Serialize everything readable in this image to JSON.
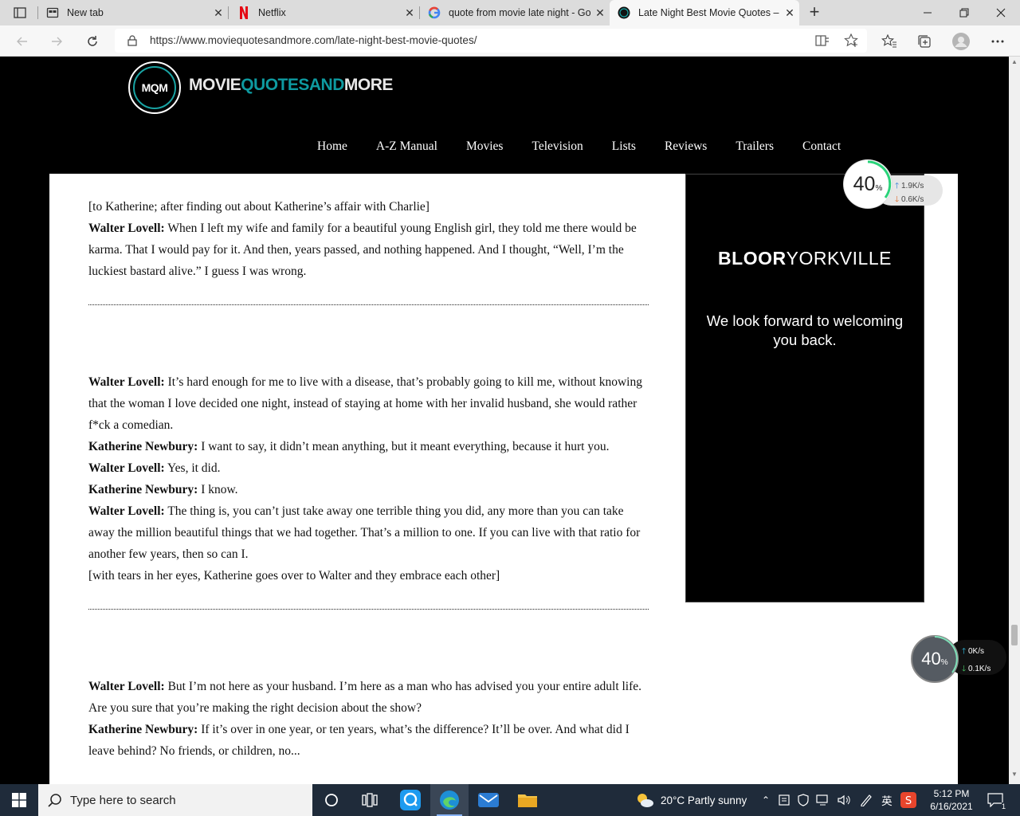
{
  "browser": {
    "tabs": [
      {
        "label": "New tab",
        "icon": "new-tab-page-icon",
        "active": false
      },
      {
        "label": "Netflix",
        "icon": "netflix-icon",
        "active": false
      },
      {
        "label": "quote from movie late night - Go",
        "icon": "google-icon",
        "active": false
      },
      {
        "label": "Late Night Best Movie Quotes –",
        "icon": "site-favicon",
        "active": true
      }
    ],
    "new_tab_symbol": "+",
    "close_symbol": "✕",
    "url": "https://www.moviequotesandmore.com/late-night-best-movie-quotes/"
  },
  "site": {
    "logo_mark": "MQM",
    "logo_word_1": "MOVIE",
    "logo_word_2": "QUOTESAND",
    "logo_word_3": "MORE",
    "nav": [
      "Home",
      "A-Z Manual",
      "Movies",
      "Television",
      "Lists",
      "Reviews",
      "Trailers",
      "Contact"
    ]
  },
  "article": {
    "block1": {
      "stage": "[to Katherine; after finding out about Katherine’s affair with Charlie]",
      "speaker": "Walter Lovell:",
      "line": " When I left my wife and family for a beautiful young English girl, they told me there would be karma. That I would pay for it. And then, years passed, and nothing happened. And I thought, “Well, I’m the luckiest bastard alive.” I guess I was wrong."
    },
    "block2": [
      {
        "speaker": "Walter Lovell:",
        "line": " It’s hard enough for me to live with a disease, that’s probably going to kill me, without knowing that the woman I love decided one night, instead of staying at home with her invalid husband, she would rather f*ck a comedian."
      },
      {
        "speaker": "Katherine Newbury:",
        "line": " I want to say, it didn’t mean anything, but it meant everything, because it hurt you."
      },
      {
        "speaker": "Walter Lovell:",
        "line": " Yes, it did."
      },
      {
        "speaker": "Katherine Newbury:",
        "line": " I know."
      },
      {
        "speaker": "Walter Lovell:",
        "line": " The thing is, you can’t just take away one terrible thing you did, any more than you can take away the million beautiful things that we had together. That’s a million to one. If you can live with that ratio for another few years, then so can I."
      }
    ],
    "block2_stage": "[with tears in her eyes, Katherine goes over to Walter and they embrace each other]",
    "block3": [
      {
        "speaker": "Walter Lovell:",
        "line": " But I’m not here as your husband. I’m here as a man who has advised you your entire adult life. Are you sure that you’re making the right decision about the show?"
      },
      {
        "speaker": "Katherine Newbury:",
        "line": " If it’s over in one year, or ten years, what’s the difference? It’ll be over. And what did I leave behind? No friends, or children, no..."
      }
    ]
  },
  "ad": {
    "brand_bold": "BLOOR",
    "brand_light": "YORKVILLE",
    "message": "We look forward to welcoming you back."
  },
  "speed_widget_top": {
    "percent": "40",
    "percent_sign": "%",
    "up": "1.9",
    "down": "0.6",
    "unit": "K/s"
  },
  "speed_widget_bottom": {
    "percent": "40",
    "percent_sign": "%",
    "up": "0",
    "down": "0.1",
    "unit": "K/s"
  },
  "taskbar": {
    "search_placeholder": "Type here to search",
    "weather": "20°C  Partly sunny",
    "ime": "英",
    "time": "5:12 PM",
    "date": "6/16/2021",
    "notification_count": "1"
  },
  "colors": {
    "teal_accent": "#0e9aa0",
    "page_bg": "#000000",
    "taskbar_bg": "#1f2b3a"
  }
}
